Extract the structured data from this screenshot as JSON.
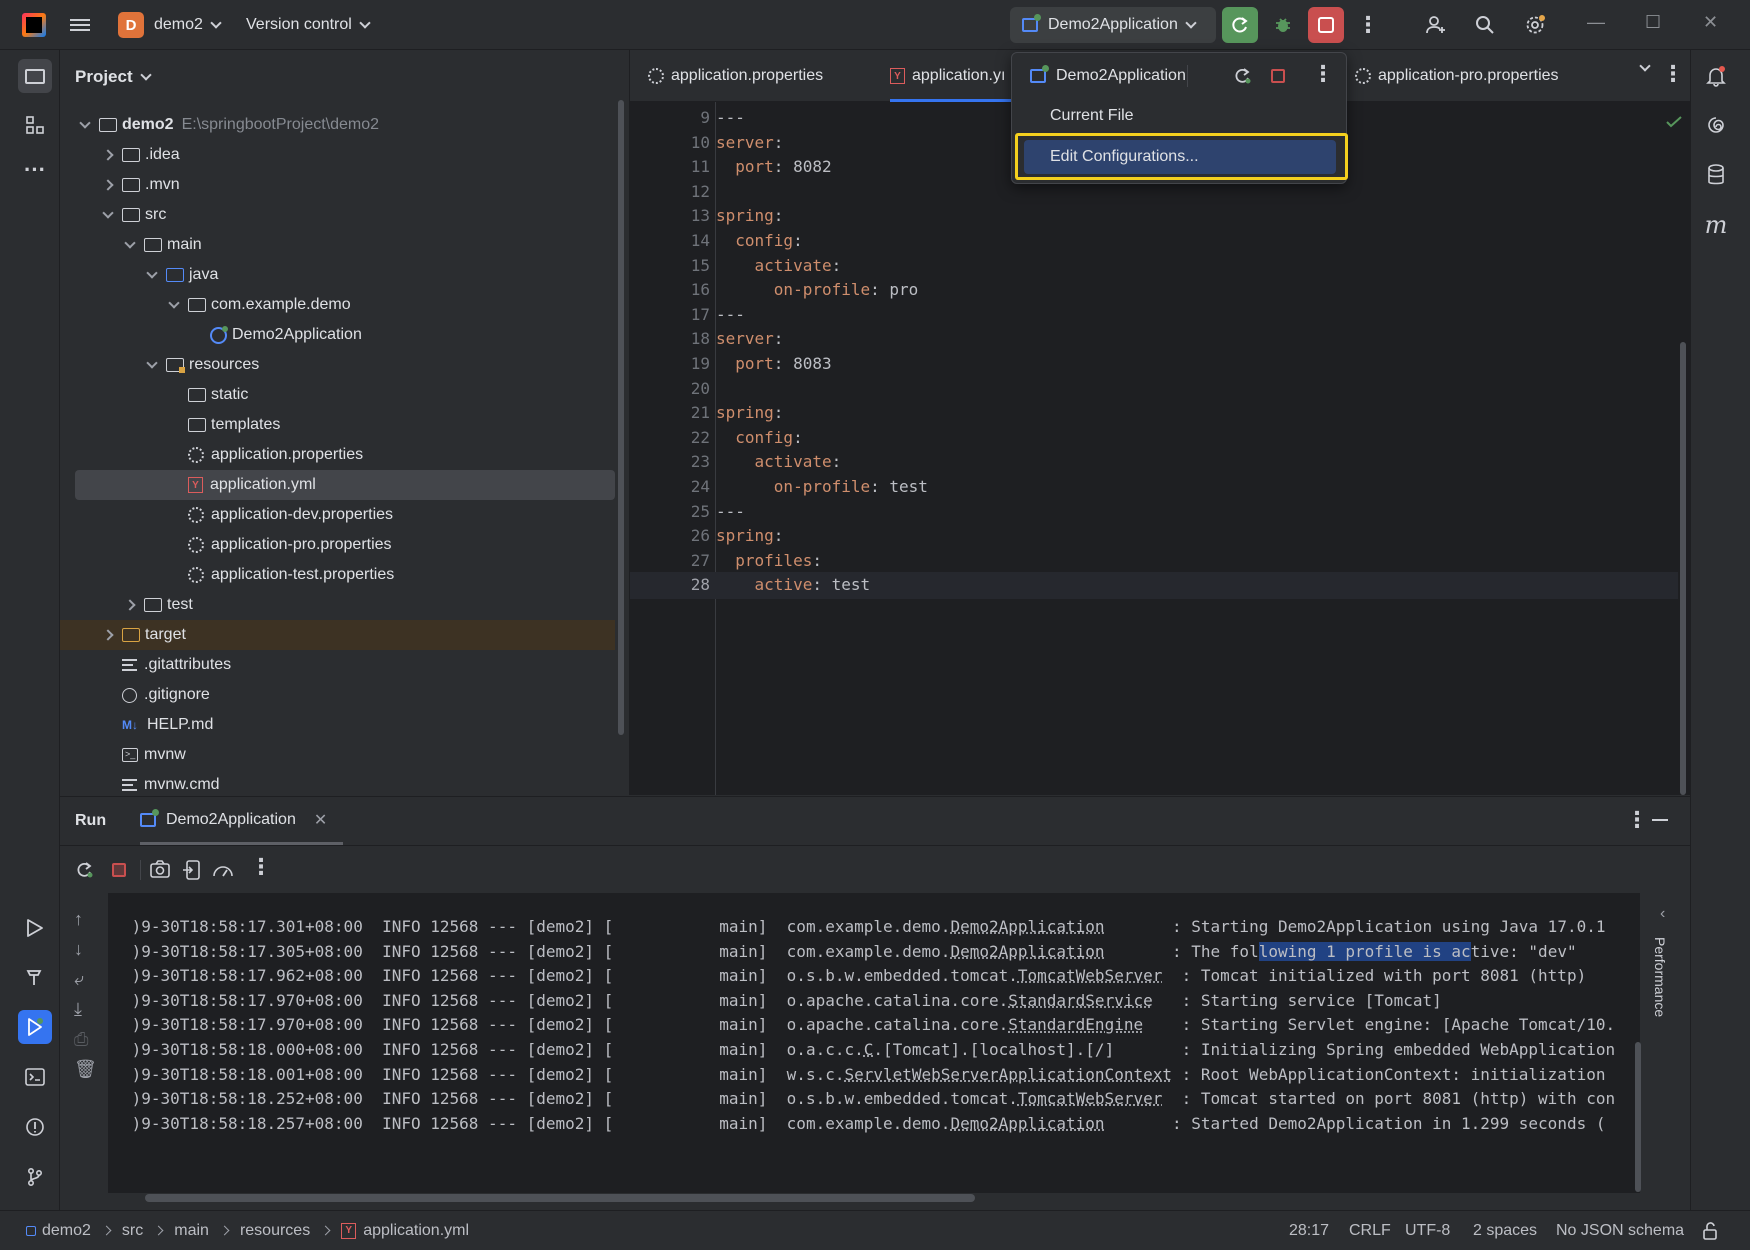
{
  "titlebar": {
    "project_letter": "D",
    "project_name": "demo2",
    "vcs": "Version control",
    "run_config": "Demo2Application"
  },
  "project_panel": {
    "title": "Project",
    "root_name": "demo2",
    "root_path": "E:\\springbootProject\\demo2",
    "items": [
      {
        "label": ".idea"
      },
      {
        "label": ".mvn"
      },
      {
        "label": "src"
      },
      {
        "label": "main"
      },
      {
        "label": "java"
      },
      {
        "label": "com.example.demo"
      },
      {
        "label": "Demo2Application"
      },
      {
        "label": "resources"
      },
      {
        "label": "static"
      },
      {
        "label": "templates"
      },
      {
        "label": "application.properties"
      },
      {
        "label": "application.yml"
      },
      {
        "label": "application-dev.properties"
      },
      {
        "label": "application-pro.properties"
      },
      {
        "label": "application-test.properties"
      },
      {
        "label": "test"
      },
      {
        "label": "target"
      },
      {
        "label": ".gitattributes"
      },
      {
        "label": ".gitignore"
      },
      {
        "label": "HELP.md"
      },
      {
        "label": "mvnw"
      },
      {
        "label": "mvnw.cmd"
      }
    ]
  },
  "editor": {
    "tabs": [
      {
        "label": "application.properties"
      },
      {
        "label": "application.yı"
      },
      {
        "label": "application-pro.properties"
      }
    ],
    "lines": [
      {
        "n": "9",
        "text": "---"
      },
      {
        "n": "10",
        "key": "server",
        "rest": ":"
      },
      {
        "n": "11",
        "indent": "  ",
        "key": "port",
        "rest": ": 8082"
      },
      {
        "n": "12",
        "text": ""
      },
      {
        "n": "13",
        "key": "spring",
        "rest": ":"
      },
      {
        "n": "14",
        "indent": "  ",
        "key": "config",
        "rest": ":"
      },
      {
        "n": "15",
        "indent": "    ",
        "key": "activate",
        "rest": ":"
      },
      {
        "n": "16",
        "indent": "      ",
        "key": "on-profile",
        "rest": ": pro"
      },
      {
        "n": "17",
        "text": "---"
      },
      {
        "n": "18",
        "key": "server",
        "rest": ":"
      },
      {
        "n": "19",
        "indent": "  ",
        "key": "port",
        "rest": ": 8083"
      },
      {
        "n": "20",
        "text": ""
      },
      {
        "n": "21",
        "key": "spring",
        "rest": ":"
      },
      {
        "n": "22",
        "indent": "  ",
        "key": "config",
        "rest": ":"
      },
      {
        "n": "23",
        "indent": "    ",
        "key": "activate",
        "rest": ":"
      },
      {
        "n": "24",
        "indent": "      ",
        "key": "on-profile",
        "rest": ": test"
      },
      {
        "n": "25",
        "text": "---"
      },
      {
        "n": "26",
        "key": "spring",
        "rest": ":"
      },
      {
        "n": "27",
        "indent": "  ",
        "key": "profiles",
        "rest": ":"
      },
      {
        "n": "28",
        "indent": "    ",
        "key": "active",
        "rest": ": test"
      }
    ]
  },
  "popup": {
    "header": "Demo2Application",
    "items": [
      {
        "label": "Current File"
      },
      {
        "label": "Edit Configurations..."
      }
    ]
  },
  "run": {
    "title": "Run",
    "tab": "Demo2Application",
    "side_label": "Performance",
    "log": [
      {
        "ts": " )9-30T18:58:17.301+08:00",
        "lvl": "INFO 12568 --- [demo2] [           main]",
        "pkg": "com.example.demo.",
        "cls": "Demo2Application",
        "pad": "       ",
        "msg": ": Starting Demo2Application using Java 17.0.1"
      },
      {
        "ts": " )9-30T18:58:17.305+08:00",
        "lvl": "INFO 12568 --- [demo2] [           main]",
        "pkg": "com.example.demo.",
        "cls": "Demo2Application",
        "pad": "       ",
        "msg_a": ": The fol",
        "msg_sel": "lowing 1 profile is ac",
        "msg_b": "tive: \"dev\""
      },
      {
        "ts": " )9-30T18:58:17.962+08:00",
        "lvl": "INFO 12568 --- [demo2] [           main]",
        "pkg": "o.s.b.w.embedded.tomcat.",
        "cls": "TomcatWebServer",
        "pad": "  ",
        "msg": ": Tomcat initialized with port 8081 (http)"
      },
      {
        "ts": " )9-30T18:58:17.970+08:00",
        "lvl": "INFO 12568 --- [demo2] [           main]",
        "pkg": "o.apache.catalina.core.",
        "cls": "StandardService",
        "pad": "   ",
        "msg": ": Starting service [Tomcat]"
      },
      {
        "ts": " )9-30T18:58:17.970+08:00",
        "lvl": "INFO 12568 --- [demo2] [           main]",
        "pkg": "o.apache.catalina.core.",
        "cls": "StandardEngine",
        "pad": "    ",
        "msg": ": Starting Servlet engine: [Apache Tomcat/10."
      },
      {
        "ts": " )9-30T18:58:18.000+08:00",
        "lvl": "INFO 12568 --- [demo2] [           main]",
        "pkg": "o.a.c.c.",
        "cls": "C",
        "pad": ".[Tomcat].[localhost].[/]       ",
        "msg": ": Initializing Spring embedded WebApplication"
      },
      {
        "ts": " )9-30T18:58:18.001+08:00",
        "lvl": "INFO 12568 --- [demo2] [           main]",
        "pkg": "w.s.c.",
        "cls": "ServletWebServerApplicationContext",
        "pad": " ",
        "msg": ": Root WebApplicationContext: initialization"
      },
      {
        "ts": " )9-30T18:58:18.252+08:00",
        "lvl": "INFO 12568 --- [demo2] [           main]",
        "pkg": "o.s.b.w.embedded.tomcat.",
        "cls": "TomcatWebServer",
        "pad": "  ",
        "msg": ": Tomcat started on port 8081 (http) with con"
      },
      {
        "ts": " )9-30T18:58:18.257+08:00",
        "lvl": "INFO 12568 --- [demo2] [           main]",
        "pkg": "com.example.demo.",
        "cls": "Demo2Application",
        "pad": "       ",
        "msg": ": Started Demo2Application in 1.299 seconds ("
      }
    ]
  },
  "statusbar": {
    "crumbs": [
      "demo2",
      "src",
      "main",
      "resources",
      "application.yml"
    ],
    "position": "28:17",
    "line_sep": "CRLF",
    "encoding": "UTF-8",
    "indent": "2 spaces",
    "schema": "No JSON schema"
  },
  "colors": {
    "accent": "#3574f0",
    "highlight_box": "#f4d01e",
    "stop": "#c94f4f",
    "run_green": "#57965c",
    "yaml_key": "#cf8e6d"
  }
}
